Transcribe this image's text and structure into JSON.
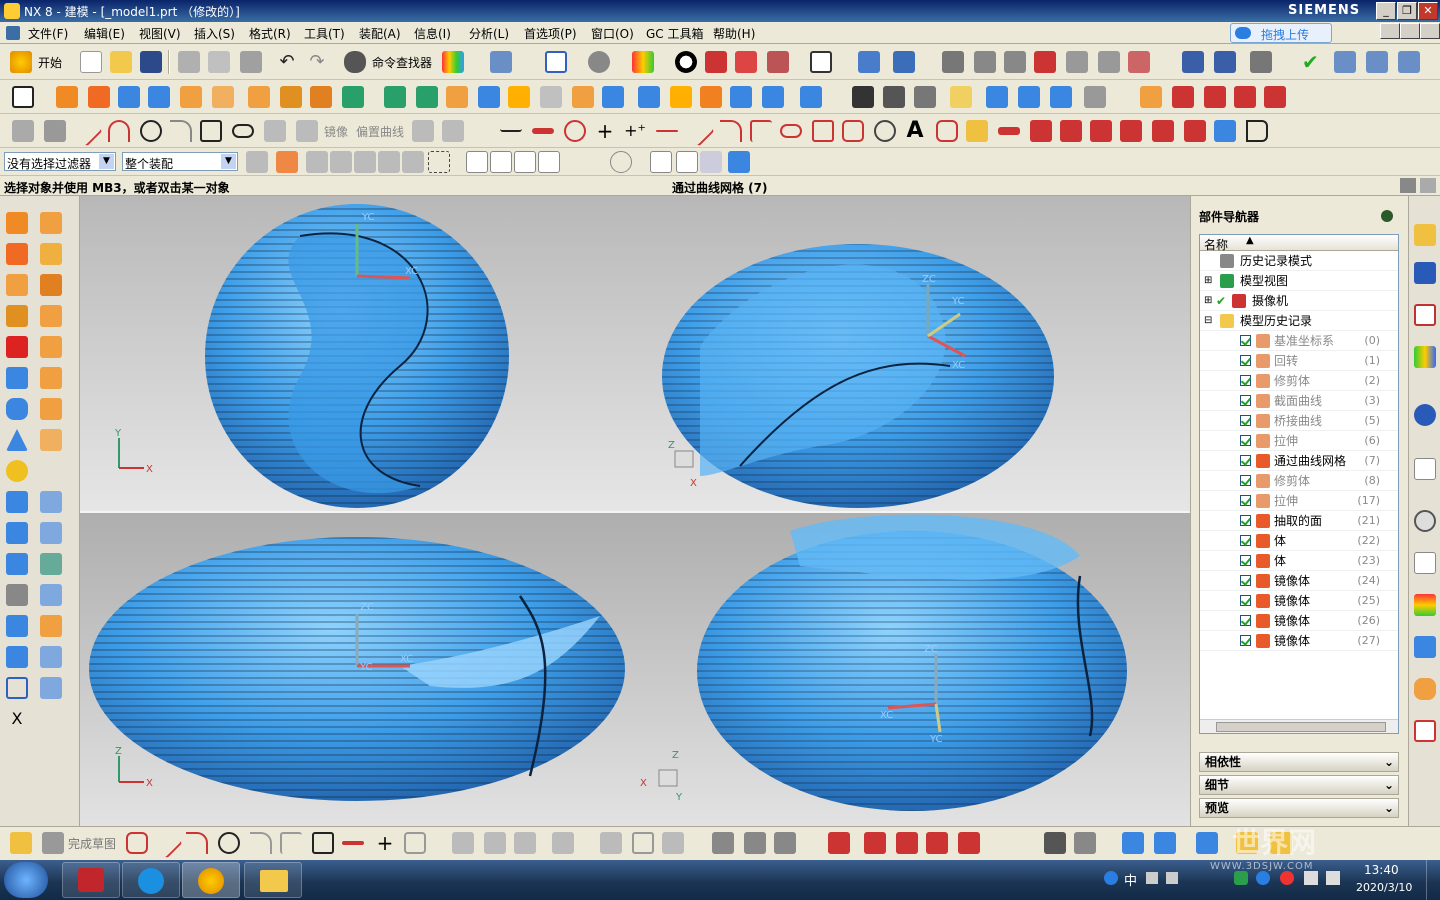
{
  "window": {
    "title": "NX 8 - 建模 - [_model1.prt （修改的）]",
    "brand": "SIEMENS",
    "controls": [
      "_",
      "❐",
      "✕"
    ]
  },
  "menubar": {
    "items": [
      "文件(F)",
      "编辑(E)",
      "视图(V)",
      "插入(S)",
      "格式(R)",
      "工具(T)",
      "装配(A)",
      "信息(I)",
      "分析(L)",
      "首选项(P)",
      "窗口(O)",
      "GC 工具箱",
      "帮助(H)"
    ],
    "upload_button": "拖拽上传"
  },
  "toolbar1": {
    "start_label": "开始",
    "command_finder_label": "命令查找器"
  },
  "toolbar3": {
    "mirror_label": "镜像",
    "offset_curve_label": "偏置曲线"
  },
  "selection_bar": {
    "filter_value": "没有选择过滤器",
    "scope_value": "整个装配"
  },
  "status": {
    "prompt": "选择对象并使用 MB3，或者双击某一对象",
    "current_feature": "通过曲线网格 (7)"
  },
  "viewport": {
    "background": "#cfcfcf",
    "surface_color": "#3f9ee8",
    "wcs_labels": {
      "xc": "XC",
      "yc": "YC",
      "zc": "ZC"
    },
    "axis_labels": {
      "x": "X",
      "y": "Y",
      "z": "Z"
    }
  },
  "part_navigator": {
    "title": "部件导航器",
    "column_name": "名称",
    "tree": [
      {
        "label": "历史记录模式",
        "level": 0,
        "type": "clock"
      },
      {
        "label": "模型视图",
        "level": 0,
        "type": "view"
      },
      {
        "label": "摄像机",
        "level": 0,
        "type": "camera"
      },
      {
        "label": "模型历史记录",
        "level": 0,
        "type": "folder"
      },
      {
        "label": "基准坐标系",
        "id": "(0)",
        "level": 1,
        "dim": true
      },
      {
        "label": "回转",
        "id": "(1)",
        "level": 1,
        "dim": true
      },
      {
        "label": "修剪体",
        "id": "(2)",
        "level": 1,
        "dim": true
      },
      {
        "label": "截面曲线",
        "id": "(3)",
        "level": 1,
        "dim": true
      },
      {
        "label": "桥接曲线",
        "id": "(5)",
        "level": 1,
        "dim": true
      },
      {
        "label": "拉伸",
        "id": "(6)",
        "level": 1,
        "dim": true
      },
      {
        "label": "通过曲线网格",
        "id": "(7)",
        "level": 1,
        "dim": false
      },
      {
        "label": "修剪体",
        "id": "(8)",
        "level": 1,
        "dim": true
      },
      {
        "label": "拉伸",
        "id": "(17)",
        "level": 1,
        "dim": true
      },
      {
        "label": "抽取的面",
        "id": "(21)",
        "level": 1,
        "dim": false
      },
      {
        "label": "体",
        "id": "(22)",
        "level": 1,
        "dim": false
      },
      {
        "label": "体",
        "id": "(23)",
        "level": 1,
        "dim": false
      },
      {
        "label": "镜像体",
        "id": "(24)",
        "level": 1,
        "dim": false
      },
      {
        "label": "镜像体",
        "id": "(25)",
        "level": 1,
        "dim": false
      },
      {
        "label": "镜像体",
        "id": "(26)",
        "level": 1,
        "dim": false
      },
      {
        "label": "镜像体",
        "id": "(27)",
        "level": 1,
        "dim": false
      }
    ],
    "panels": [
      "相依性",
      "细节",
      "预览"
    ]
  },
  "bottom_toolbar": {
    "finish_sketch_label": "完成草图"
  },
  "taskbar": {
    "time": "13:40",
    "date": "2020/3/10",
    "ime": "中",
    "watermark": "世界网",
    "watermark_url": "WWW.3DSJW.COM"
  }
}
